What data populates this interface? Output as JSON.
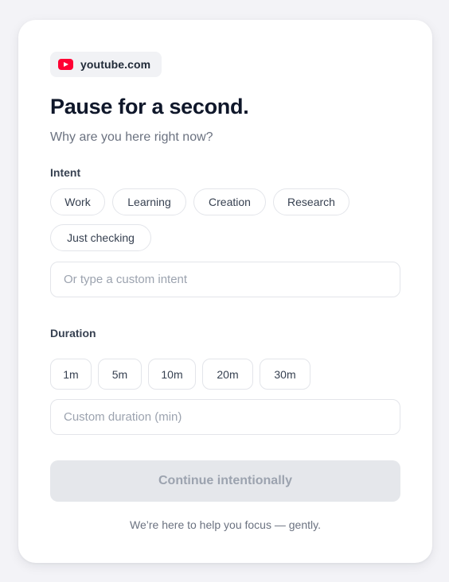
{
  "site": {
    "icon": "youtube-icon",
    "name": "youtube.com",
    "icon_color": "#ff0033"
  },
  "header": {
    "title": "Pause for a second.",
    "subtitle": "Why are you here right now?"
  },
  "intent": {
    "label": "Intent",
    "options": [
      "Work",
      "Learning",
      "Creation",
      "Research",
      "Just checking"
    ],
    "custom_placeholder": "Or type a custom intent",
    "custom_value": ""
  },
  "duration": {
    "label": "Duration",
    "options": [
      "1m",
      "5m",
      "10m",
      "20m",
      "30m"
    ],
    "custom_placeholder": "Custom duration (min)",
    "custom_value": ""
  },
  "actions": {
    "continue_label": "Continue intentionally",
    "continue_enabled": false
  },
  "footer": {
    "note": "We’re here to help you focus — gently."
  },
  "colors": {
    "background": "#f3f3f7",
    "card": "#ffffff",
    "disabled_button": "#e5e7eb",
    "disabled_text": "#9ca3af"
  }
}
